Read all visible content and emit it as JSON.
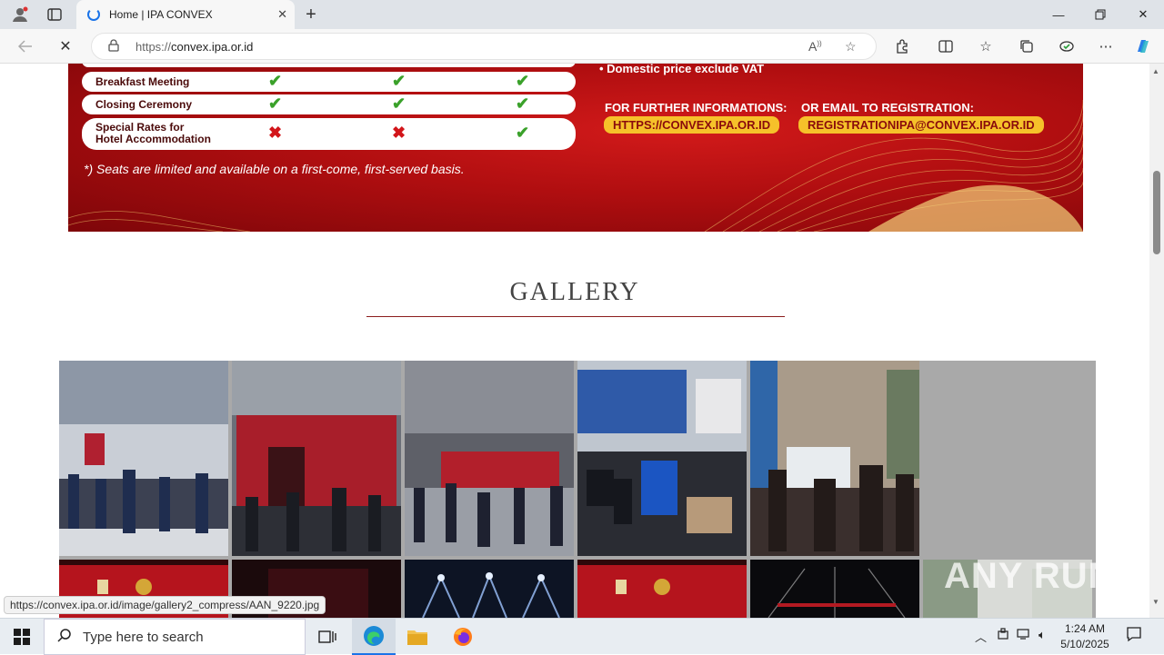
{
  "browser": {
    "tab_title": "Home | IPA CONVEX",
    "url_proto": "https://",
    "url_host": "convex.ipa.or.id",
    "status_url": "https://convex.ipa.or.id/image/gallery2_compress/AAN_9220.jpg"
  },
  "banner": {
    "rows": [
      {
        "label": "Breakfast Meeting",
        "marks": [
          "check",
          "check",
          "check"
        ]
      },
      {
        "label": "Closing Ceremony",
        "marks": [
          "check",
          "check",
          "check"
        ]
      },
      {
        "label": "Special Rates for",
        "label2": "Hotel Accommodation",
        "marks": [
          "cross",
          "cross",
          "check"
        ]
      }
    ],
    "note": "*) Seats are limited and available on a first-come, first-served basis.",
    "bullet": "• Domestic price exclude VAT",
    "info_label": "FOR FURTHER INFORMATIONS:",
    "info_link": "HTTPS://CONVEX.IPA.OR.ID",
    "email_label": "OR EMAIL TO REGISTRATION:",
    "email_link": "REGISTRATIONIPA@CONVEX.IPA.OR.ID"
  },
  "gallery": {
    "title": "GALLERY"
  },
  "watermark": "ANY RUN",
  "taskbar": {
    "search_placeholder": "Type here to search",
    "time": "1:24 AM",
    "date": "5/10/2025"
  },
  "colors": {
    "banner_red": "#b00e10",
    "check_green": "#3aa12a",
    "cross_red": "#d2151a",
    "pill_yellow": "#f6c12a",
    "title_underline": "#8b1d1d"
  }
}
